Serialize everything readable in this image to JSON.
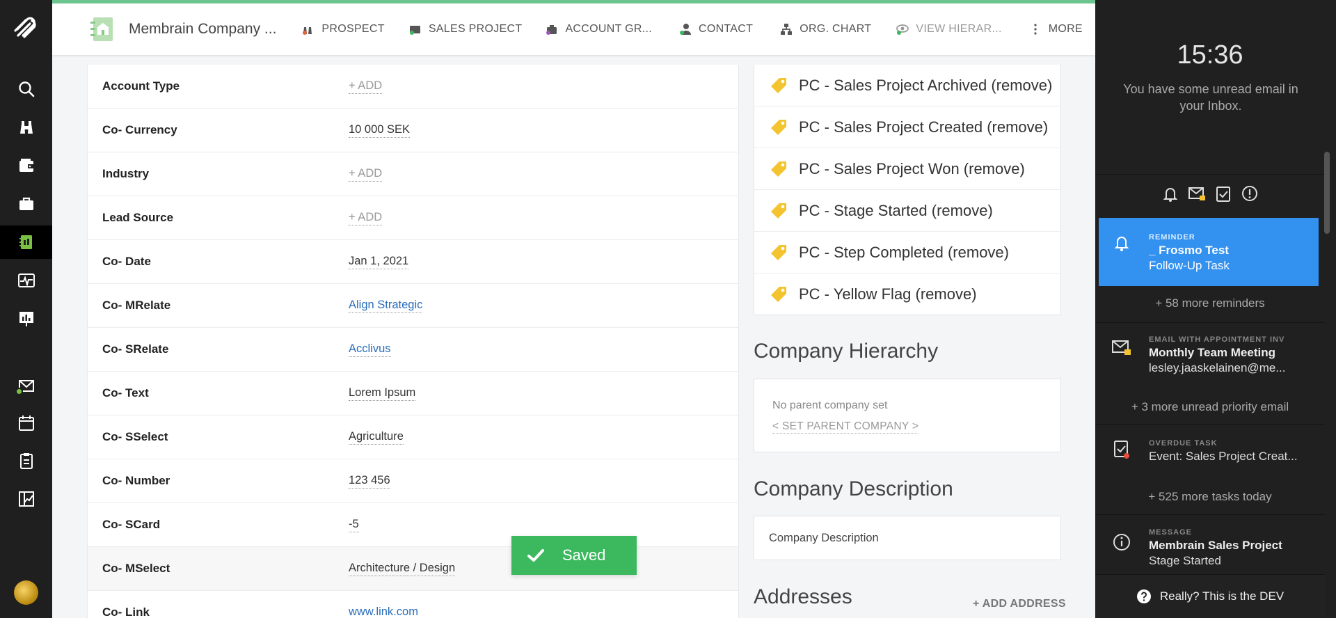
{
  "header": {
    "company_title": "Membrain Company ...",
    "tabs": [
      {
        "label": "PROSPECT",
        "icon": "prospect-icon"
      },
      {
        "label": "SALES PROJECT",
        "icon": "sales-project-icon"
      },
      {
        "label": "ACCOUNT GR...",
        "icon": "account-group-icon"
      },
      {
        "label": "CONTACT",
        "icon": "contact-icon"
      },
      {
        "label": "ORG. CHART",
        "icon": "org-chart-icon"
      },
      {
        "label": "VIEW HIERAR...",
        "icon": "view-hierarchy-icon"
      },
      {
        "label": "MORE",
        "icon": "more-vertical-icon"
      }
    ],
    "accent_color": "#6cc58f"
  },
  "fields": [
    {
      "label": "Account Type",
      "value": "+ ADD",
      "kind": "add"
    },
    {
      "label": "Co- Currency",
      "value": "10 000 SEK",
      "kind": "text"
    },
    {
      "label": "Industry",
      "value": "+ ADD",
      "kind": "add"
    },
    {
      "label": "Lead Source",
      "value": "+ ADD",
      "kind": "add"
    },
    {
      "label": "Co- Date",
      "value": "Jan 1, 2021",
      "kind": "text"
    },
    {
      "label": "Co- MRelate",
      "value": "Align Strategic",
      "kind": "link"
    },
    {
      "label": "Co- SRelate",
      "value": "Acclivus",
      "kind": "link"
    },
    {
      "label": "Co- Text",
      "value": "Lorem Ipsum",
      "kind": "text"
    },
    {
      "label": "Co- SSelect",
      "value": "Agriculture",
      "kind": "text"
    },
    {
      "label": "Co- Number",
      "value": "123 456",
      "kind": "text"
    },
    {
      "label": "Co- SCard",
      "value": "-5",
      "kind": "text"
    },
    {
      "label": "Co- MSelect",
      "value": "Architecture / Design",
      "kind": "text"
    },
    {
      "label": "Co- Link",
      "value": "www.link.com",
      "kind": "link"
    }
  ],
  "toast": {
    "label": "Saved",
    "color": "#3cb95e"
  },
  "tags": [
    "PC - Sales Project Archived (remove)",
    "PC - Sales Project Created (remove)",
    "PC - Sales Project Won (remove)",
    "PC - Stage Started (remove)",
    "PC - Step Completed (remove)",
    "PC - Yellow Flag (remove)"
  ],
  "hierarchy": {
    "title": "Company Hierarchy",
    "no_parent": "No parent company set",
    "set_parent": "< SET PARENT COMPANY >"
  },
  "description": {
    "title": "Company Description",
    "value": "Company Description"
  },
  "addresses": {
    "title": "Addresses",
    "add_label": "+ ADD ADDRESS"
  },
  "panel": {
    "time": "15:36",
    "unread_message": "You have some unread email in your Inbox.",
    "reminder": {
      "category": "REMINDER",
      "title": "_ Frosmo Test",
      "subtitle": "Follow-Up Task",
      "color": "#3391f0"
    },
    "more_reminders": "+ 58 more reminders",
    "email": {
      "category": "EMAIL WITH APPOINTMENT INV",
      "title": "Monthly Team Meeting",
      "subtitle": "lesley.jaaskelainen@me..."
    },
    "more_email": "+ 3 more unread priority email",
    "task": {
      "category": "OVERDUE TASK",
      "title": "Event: Sales Project Creat..."
    },
    "more_tasks": "+ 525 more tasks today",
    "message": {
      "category": "MESSAGE",
      "title": "Membrain Sales Project",
      "subtitle": "Stage Started"
    },
    "bottom_text": "Really? This is the DEV"
  }
}
